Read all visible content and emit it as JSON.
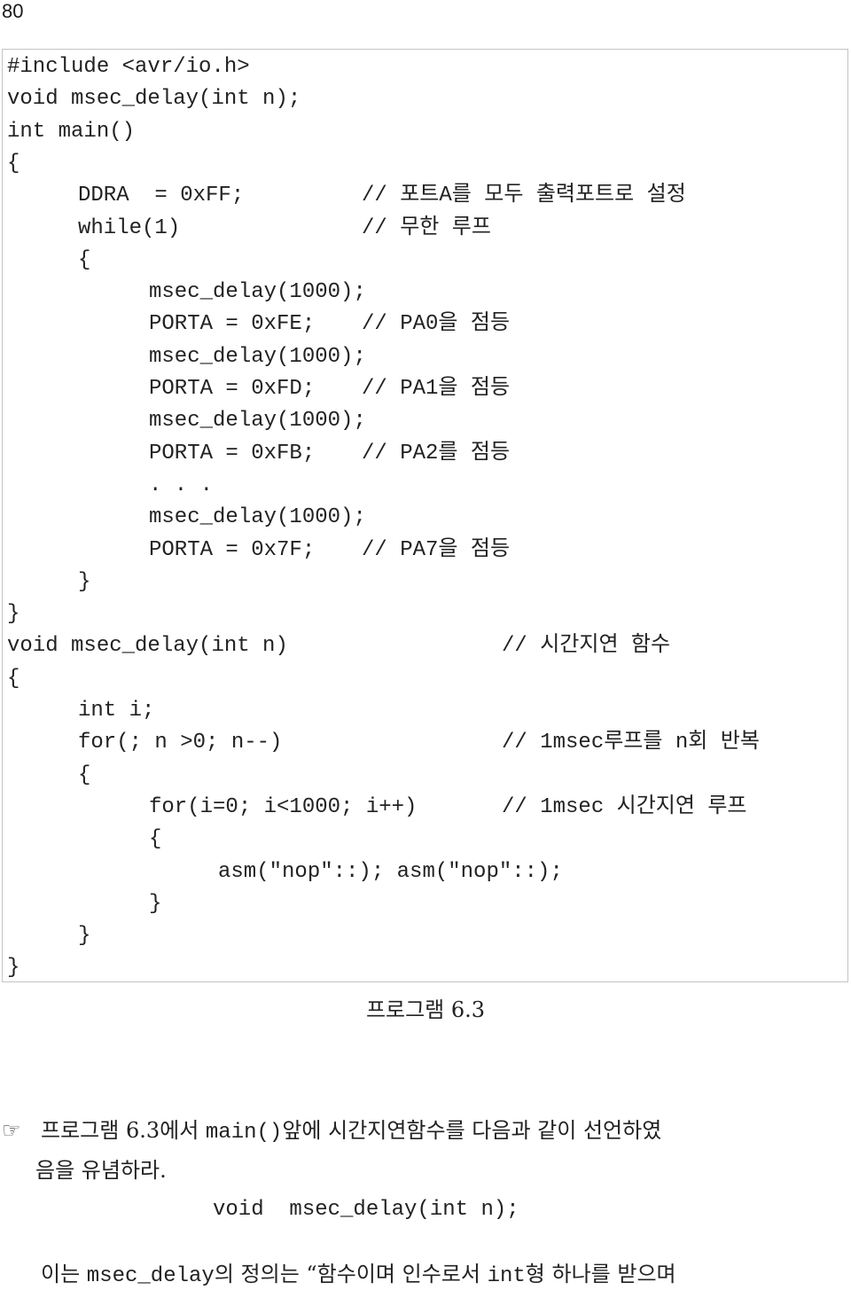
{
  "page": {
    "number": "80"
  },
  "code": {
    "lines": [
      {
        "code": "#include <avr/io.h>",
        "comment": ""
      },
      {
        "code": "void msec_delay(int n);",
        "comment": ""
      },
      {
        "code": "int main()",
        "comment": ""
      },
      {
        "code": "{",
        "comment": ""
      },
      {
        "code": "DDRA  = 0xFF;",
        "comment": "// 포트A를 모두 출력포트로 설정"
      },
      {
        "code": "while(1)",
        "comment": "// 무한 루프"
      },
      {
        "code": "{",
        "comment": ""
      },
      {
        "code": "msec_delay(1000);",
        "comment": ""
      },
      {
        "code": "PORTA = 0xFE;",
        "comment": "// PA0을 점등"
      },
      {
        "code": "msec_delay(1000);",
        "comment": ""
      },
      {
        "code": "PORTA = 0xFD;",
        "comment": "// PA1을 점등"
      },
      {
        "code": "msec_delay(1000);",
        "comment": ""
      },
      {
        "code": "PORTA = 0xFB;",
        "comment": "// PA2를 점등"
      },
      {
        "code": ". . .",
        "comment": ""
      },
      {
        "code": "msec_delay(1000);",
        "comment": ""
      },
      {
        "code": "PORTA = 0x7F;",
        "comment": "// PA7을 점등"
      },
      {
        "code": "}",
        "comment": ""
      },
      {
        "code": "}",
        "comment": ""
      },
      {
        "code": "void msec_delay(int n)",
        "comment": "// 시간지연 함수"
      },
      {
        "code": "{",
        "comment": ""
      },
      {
        "code": "int i;",
        "comment": ""
      },
      {
        "code": "for(; n >0; n--)",
        "comment": "// 1msec루프를 n회 반복"
      },
      {
        "code": "{",
        "comment": ""
      },
      {
        "code": "for(i=0; i<1000; i++)",
        "comment": "// 1msec 시간지연 루프"
      },
      {
        "code": "{",
        "comment": ""
      },
      {
        "code": "asm(\"nop\"::); asm(\"nop\"::);",
        "comment": ""
      },
      {
        "code": "}",
        "comment": ""
      },
      {
        "code": "}",
        "comment": ""
      },
      {
        "code": "}",
        "comment": ""
      }
    ]
  },
  "caption": "프로그램 6.3",
  "note": {
    "icon": "pointing-hand-icon",
    "icon_glyph": "☞",
    "paragraph1_part1": "프로그램 6.3에서 ",
    "paragraph1_code": "main()",
    "paragraph1_part2": "앞에 시간지연함수를 다음과 같이 선언하였",
    "paragraph1_line2": "음을 유념하라.",
    "declaration": "void  msec_delay(int n);",
    "paragraph2_part1": "이는 ",
    "paragraph2_code1": "msec_delay",
    "paragraph2_part2": "의 정의는 “함수이며 인수로서 ",
    "paragraph2_code2": "int",
    "paragraph2_part3": "형 하나를 받으며"
  }
}
